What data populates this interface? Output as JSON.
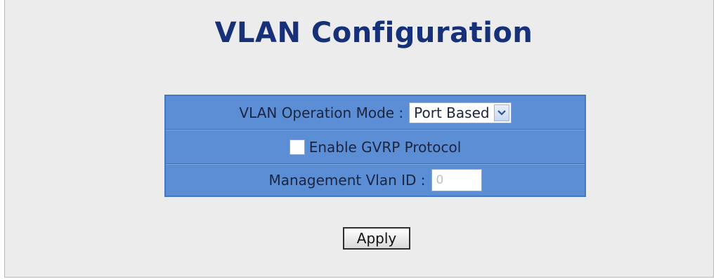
{
  "page": {
    "title": "VLAN Configuration"
  },
  "form": {
    "operation_mode_label": "VLAN Operation Mode :",
    "operation_mode_value": "Port Based",
    "gvrp_label": "Enable GVRP Protocol",
    "gvrp_checked": false,
    "mgmt_vlan_label": "Management Vlan ID :",
    "mgmt_vlan_value": "0"
  },
  "actions": {
    "apply_label": "Apply"
  },
  "colors": {
    "title": "#16317a",
    "table_bg": "#5b8ed4",
    "page_bg": "#ececec"
  },
  "icons": {
    "select_arrow": "chevron-down-icon"
  }
}
